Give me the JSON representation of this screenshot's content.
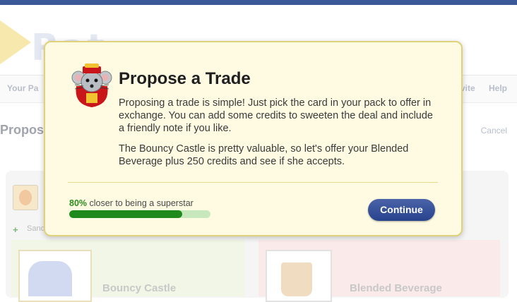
{
  "background": {
    "nav_left": "Your Pa",
    "nav_right_items": [
      "vite",
      "Help"
    ],
    "page_title": "Propos",
    "cancel_label": "Cancel",
    "sand_label": "Sand",
    "card_left_name": "Bouncy Castle",
    "card_right_name": "Blended Beverage"
  },
  "modal": {
    "title": "Propose a Trade",
    "paragraph1": "Proposing a trade is simple! Just pick the card in your pack to offer in exchange. You can add some credits to sweeten the deal and include a friendly note if you like.",
    "paragraph2": "The Bouncy Castle is pretty valuable, so let's offer your Blended Beverage plus 250 credits and see if she accepts.",
    "progress": {
      "percent_label": "80%",
      "caption": " closer to being a superstar",
      "value": 0.8
    },
    "continue_label": "Continue",
    "mascot_icon": "mouse-mascot-icon"
  },
  "colors": {
    "modal_bg": "#fefbe2",
    "modal_border": "#e0d27a",
    "progress_fill": "#1f8a1c",
    "button_bg": "#2f4a93"
  }
}
